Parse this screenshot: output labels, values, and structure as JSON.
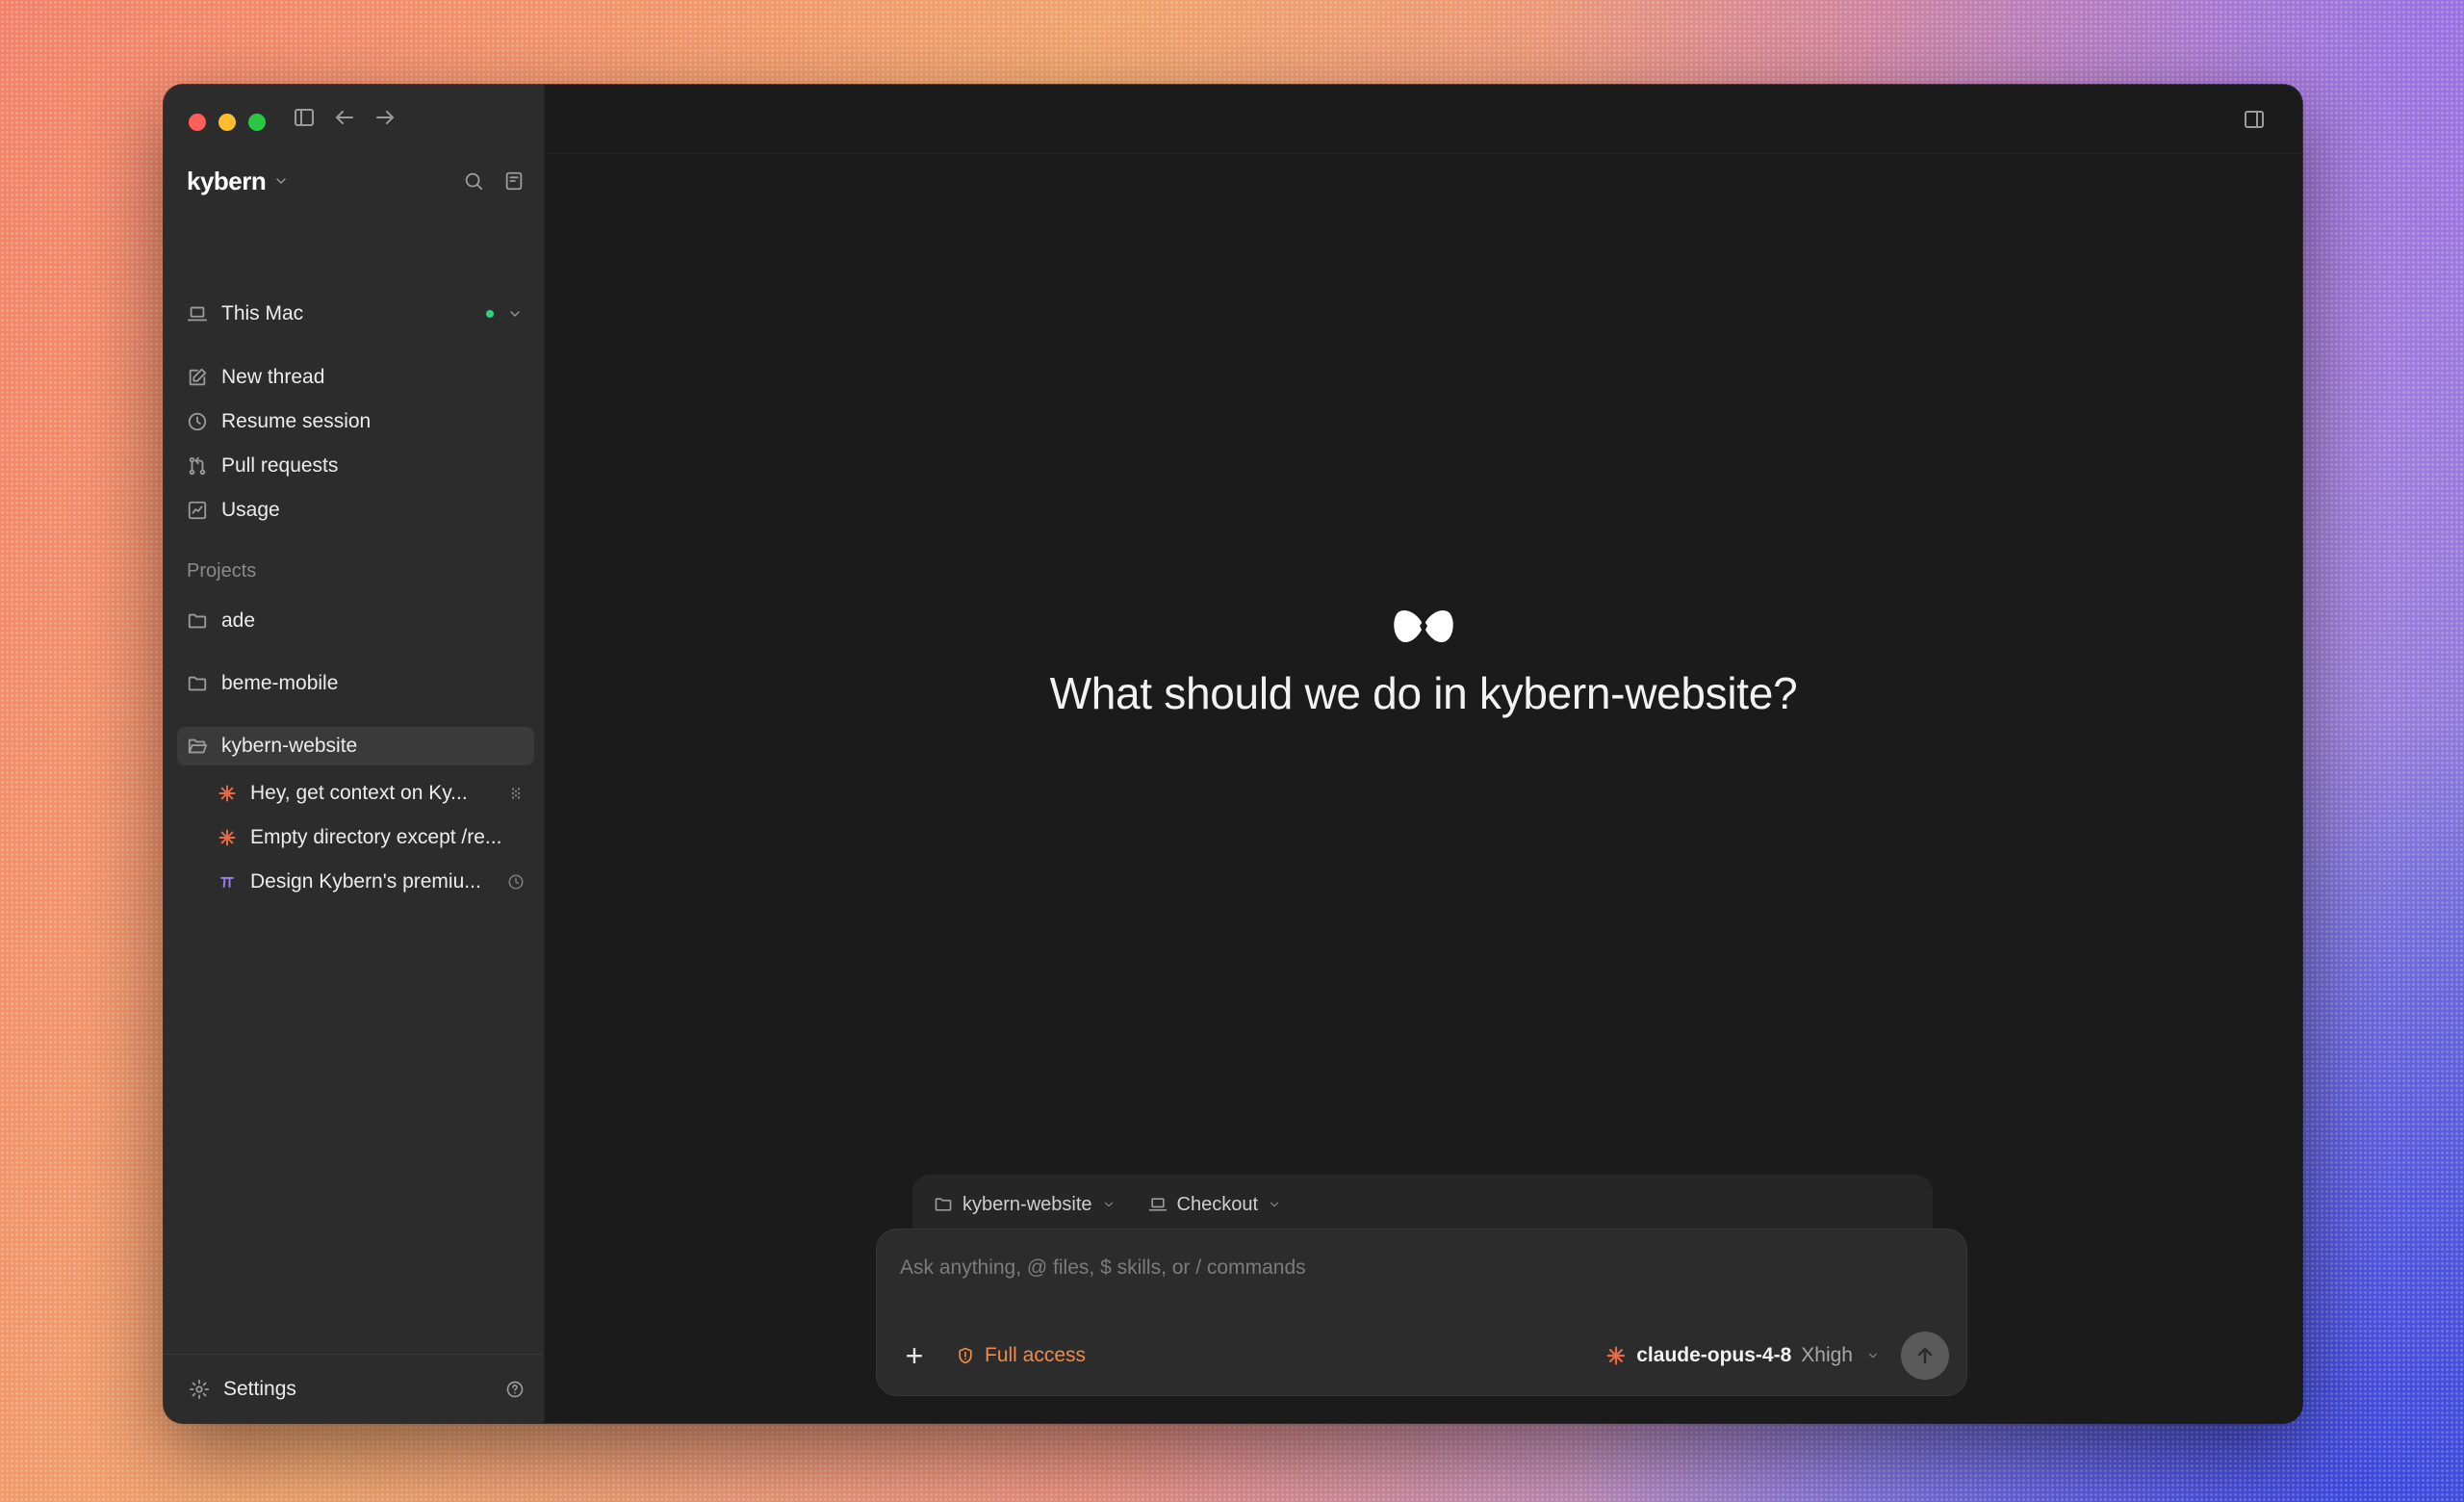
{
  "sidebar": {
    "brand": "kybern",
    "machine": {
      "label": "This Mac",
      "status_color": "#2fd47a"
    },
    "nav": [
      {
        "label": "New thread",
        "icon": "edit-icon"
      },
      {
        "label": "Resume session",
        "icon": "clock-icon"
      },
      {
        "label": "Pull requests",
        "icon": "pull-request-icon"
      },
      {
        "label": "Usage",
        "icon": "chart-icon"
      }
    ],
    "projects_title": "Projects",
    "projects": [
      {
        "label": "ade"
      },
      {
        "label": "beme-mobile"
      },
      {
        "label": "kybern-website",
        "active": true
      }
    ],
    "threads": [
      {
        "label": "Hey, get context on Ky...",
        "icon": "claude-spark-icon"
      },
      {
        "label": "Empty directory except /re...",
        "icon": "claude-spark-icon"
      },
      {
        "label": "Design Kybern's premiu...",
        "icon": "pi-icon"
      }
    ],
    "settings": {
      "label": "Settings"
    }
  },
  "main": {
    "hero_title": "What should we do in kybern-website?",
    "context": {
      "project": "kybern-website",
      "branch": "Checkout"
    },
    "composer": {
      "placeholder": "Ask anything, @ files, $ skills, or / commands",
      "value": "",
      "access_label": "Full access",
      "access_color": "#f08a4b",
      "model_name": "claude-opus-4-8",
      "model_level": "Xhigh"
    }
  },
  "colors": {
    "sidebar_bg": "#2c2c2c",
    "main_bg": "#1b1b1b",
    "claude_orange": "#e66a45",
    "pi_purple": "#9b7bf0"
  }
}
